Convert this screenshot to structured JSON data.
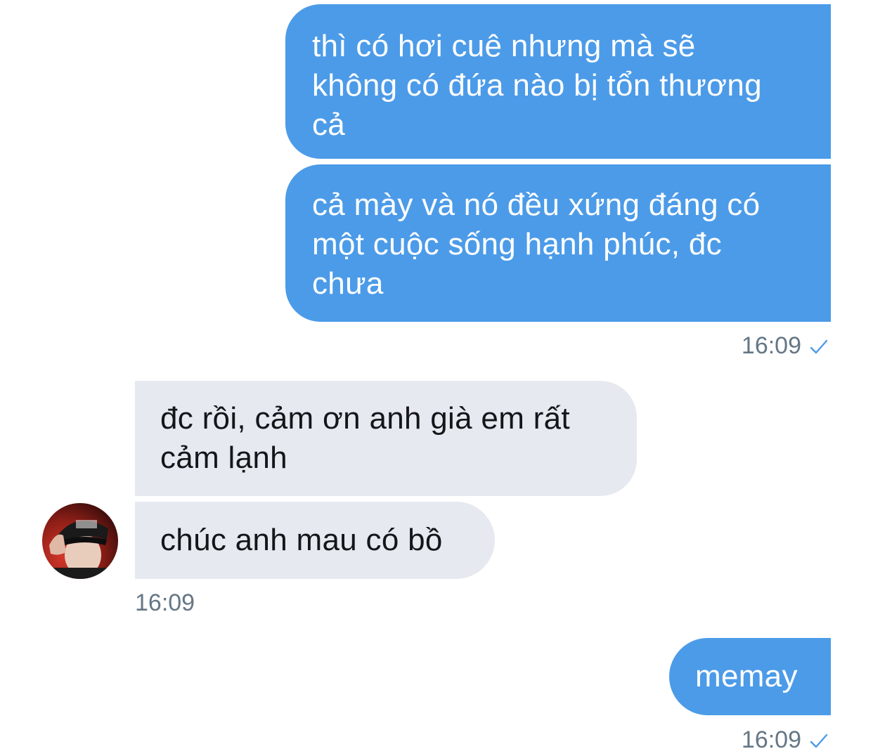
{
  "conversation": {
    "accent_color": "#4c9be8",
    "received_color": "#e6e9ef",
    "messages": [
      {
        "sender": "me",
        "text": "thì có hơi cuê nhưng mà sẽ\nkhông có đứa nào bị tổn thương\ncả"
      },
      {
        "sender": "me",
        "text": "cả mày và nó đều xứng đáng có\nmột cuộc sống hạnh phúc, đc\nchưa",
        "time": "16:09",
        "status_icon": "check-icon"
      },
      {
        "sender": "them",
        "text": "đc rồi, cảm ơn anh già em rất\ncảm lạnh"
      },
      {
        "sender": "them",
        "text": "chúc anh mau có bồ",
        "time": "16:09",
        "avatar_icon": "avatar-photo"
      },
      {
        "sender": "me",
        "text": "memay",
        "time": "16:09",
        "status_icon": "check-icon"
      }
    ]
  }
}
